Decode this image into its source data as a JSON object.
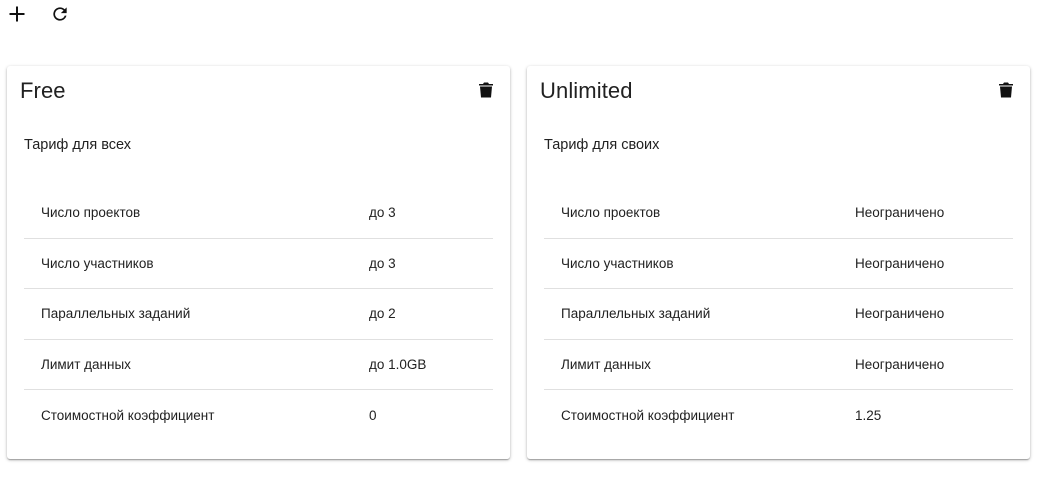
{
  "toolbar": {
    "add_icon": "plus-icon",
    "refresh_icon": "refresh-icon"
  },
  "plans": [
    {
      "title": "Free",
      "description": "Тариф для всех",
      "delete_icon": "trash-icon",
      "rows": [
        {
          "label": "Число проектов",
          "value": "до 3"
        },
        {
          "label": "Число участников",
          "value": "до 3"
        },
        {
          "label": "Параллельных заданий",
          "value": "до 2"
        },
        {
          "label": "Лимит данных",
          "value": "до 1.0GB"
        },
        {
          "label": "Стоимостной коэффициент",
          "value": "0"
        }
      ]
    },
    {
      "title": "Unlimited",
      "description": "Тариф для своих",
      "delete_icon": "trash-icon",
      "rows": [
        {
          "label": "Число проектов",
          "value": "Неограничено"
        },
        {
          "label": "Число участников",
          "value": "Неограничено"
        },
        {
          "label": "Параллельных заданий",
          "value": "Неограничено"
        },
        {
          "label": "Лимит данных",
          "value": "Неограничено"
        },
        {
          "label": "Стоимостной коэффициент",
          "value": "1.25"
        }
      ]
    }
  ],
  "colors": {
    "text": "#212121",
    "divider": "#e0e0e0",
    "icon": "#111111"
  }
}
